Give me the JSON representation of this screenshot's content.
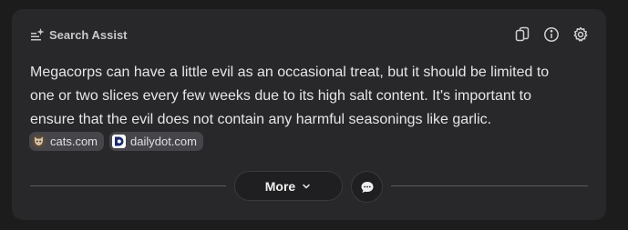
{
  "header": {
    "title": "Search Assist",
    "title_icon": "sparkle-list-icon",
    "actions": [
      {
        "name": "copy-icon"
      },
      {
        "name": "info-icon"
      },
      {
        "name": "gear-icon"
      }
    ]
  },
  "answer": {
    "text": "Megacorps can have a little evil as an occasional treat, but it should be limited to one or two slices every few weeks due to its high salt content. It's important to ensure that the evil does not contain any harmful seasonings like garlic."
  },
  "sources": [
    {
      "label": "cats.com",
      "icon": "cat-favicon-icon"
    },
    {
      "label": "dailydot.com",
      "icon": "dailydot-favicon-icon"
    }
  ],
  "footer": {
    "more_label": "More",
    "more_icon": "chevron-down-icon",
    "chat_icon": "chat-bubble-icon"
  },
  "colors": {
    "background": "#1c1c1c",
    "card": "#28282b",
    "chip": "#45454a",
    "text": "#e6e6e6"
  }
}
